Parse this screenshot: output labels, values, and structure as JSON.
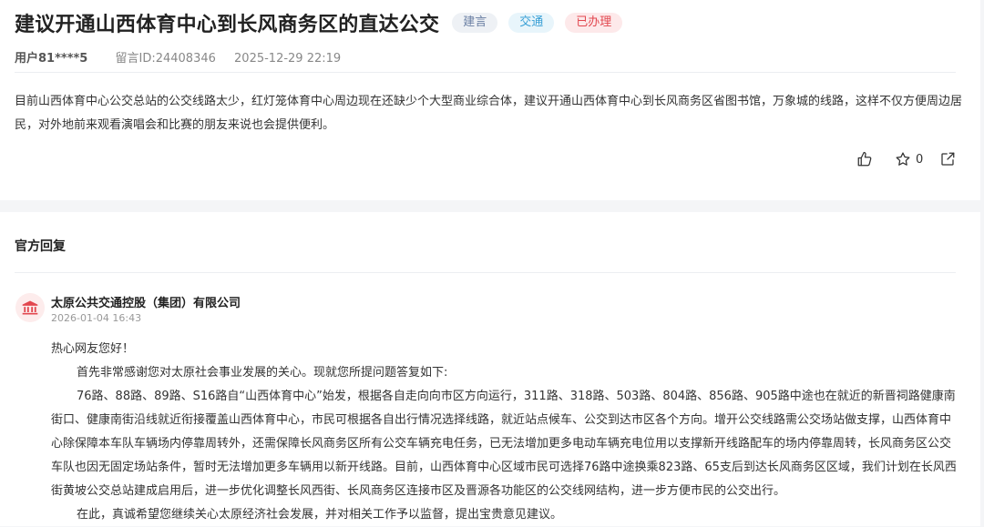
{
  "post": {
    "title": "建议开通山西体育中心到长风商务区的直达公交",
    "tags": [
      "建言",
      "交通",
      "已办理"
    ],
    "user": "用户81****5",
    "message_id": "留言ID:24408346",
    "datetime": "2025-12-29 22:19",
    "content": "目前山西体育中心公交总站的公交线路太少，红灯笼体育中心周边现在还缺少个大型商业综合体，建议开通山西体育中心到长风商务区省图书馆，万象城的线路，这样不仅方便周边居民，对外地前来观看演唱会和比赛的朋友来说也会提供便利。",
    "favorite_count": "0",
    "icons": {
      "like": "thumbs-up-icon",
      "favorite": "star-icon",
      "share": "share-icon"
    }
  },
  "official_reply": {
    "section_title": "官方回复",
    "org_name": "太原公共交通控股（集团）有限公司",
    "org_icon": "building-icon",
    "datetime": "2026-01-04 16:43",
    "greeting": "热心网友您好！",
    "paragraphs": [
      "首先非常感谢您对太原社会事业发展的关心。现就您所提问题答复如下:",
      "76路、88路、89路、S16路自“山西体育中心”始发，根据各自走向向市区方向运行，311路、318路、503路、804路、856路、905路中途也在就近的新晋祠路健康南街口、健康南街沿线就近衔接覆盖山西体育中心，市民可根据各自出行情况选择线路，就近站点候车、公交到达市区各个方向。增开公交线路需公交场站做支撑，山西体育中心除保障本车队车辆场内停靠周转外，还需保障长风商务区所有公交车辆充电任务，已无法增加更多电动车辆充电位用以支撑新开线路配车的场内停靠周转，长风商务区公交车队也因无固定场站条件，暂时无法增加更多车辆用以新开线路。目前，山西体育中心区域市民可选择76路中途换乘823路、65支后到达长风商务区区域，我们计划在长风西街黄坡公交总站建成启用后，进一步优化调整长风西街、长风商务区连接市区及晋源各功能区的公交线网结构，进一步方便市民的公交出行。",
      "在此，真诚希望您继续关心太原经济社会发展，并对相关工作予以监督，提出宝贵意见建议。"
    ]
  },
  "colors": {
    "tag_suggestion": "#6a7fa3",
    "tag_traffic": "#3aa0d6",
    "tag_done": "#e2474f",
    "org_icon": "#e2474f",
    "page_bg": "#f4f5f7"
  }
}
